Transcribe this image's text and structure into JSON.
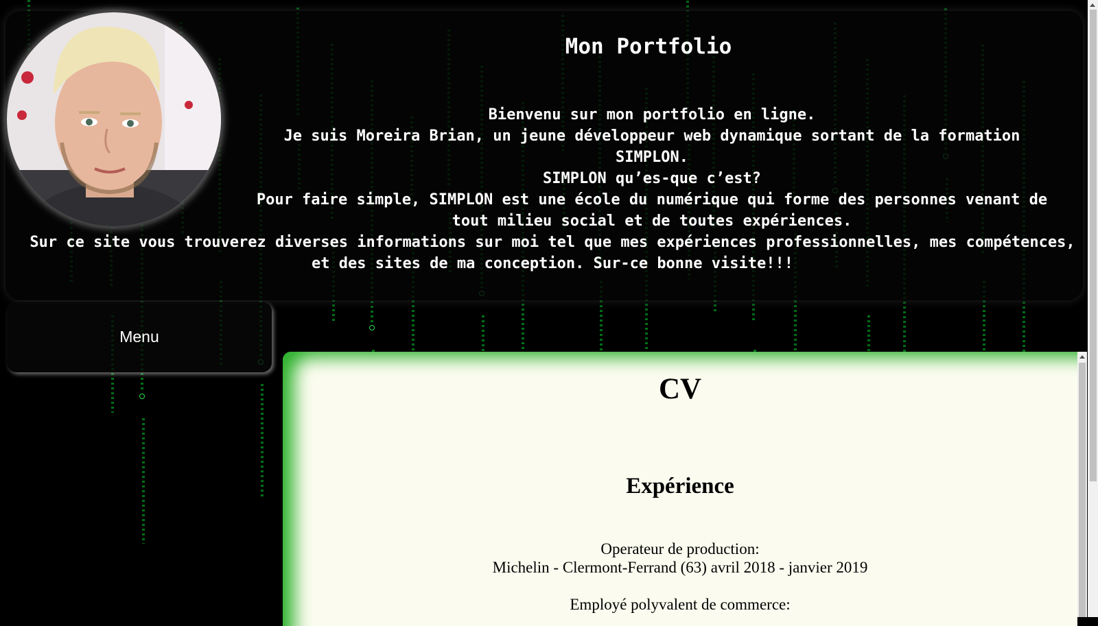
{
  "header": {
    "title": "Mon Portfolio",
    "intro_lines": [
      "Bienvenu sur mon portfolio en ligne.",
      "Je suis Moreira Brian, un jeune développeur web dynamique sortant de la formation SIMPLON.",
      "SIMPLON qu’es-que c’est?",
      "Pour faire simple, SIMPLON est une école du numérique qui forme des personnes venant de tout milieu social et de toutes expériences.",
      "Sur ce site vous trouverez diverses informations sur moi tel que mes expériences professionnelles, mes compétences, et des sites de ma conception. Sur-ce bonne visite!!!"
    ]
  },
  "menu": {
    "label": "Menu"
  },
  "cv": {
    "title": "CV",
    "section": "Expérience",
    "jobs": [
      {
        "role": "Operateur de production:",
        "details": "Michelin - Clermont-Ferrand (63) avril 2018 - janvier 2019"
      },
      {
        "role": "Employé polyvalent de commerce:",
        "details": ""
      }
    ]
  },
  "colors": {
    "accent_green": "#2bb02b",
    "panel_bg": "#fbfcef",
    "page_bg": "#000000"
  }
}
